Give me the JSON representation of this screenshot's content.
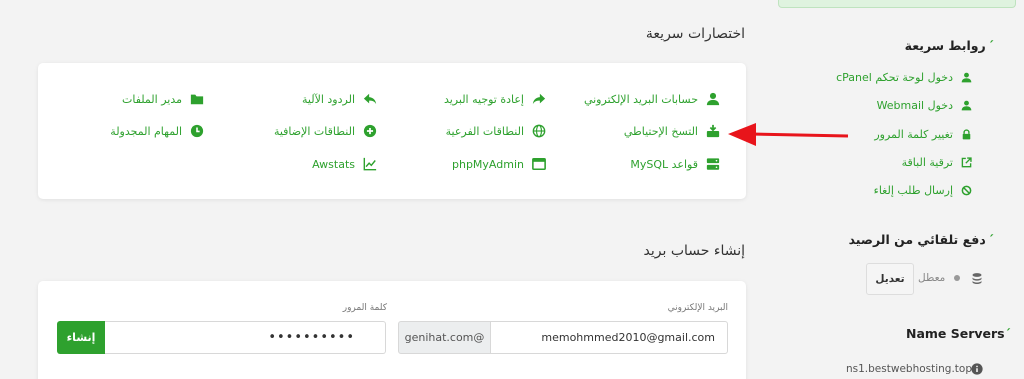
{
  "shortcuts": {
    "title": "اختصارات سريعة",
    "items": [
      {
        "label": "حسابات البريد الإلكتروني",
        "icon": "user-icon"
      },
      {
        "label": "إعادة توجيه البريد",
        "icon": "share-arrow-icon"
      },
      {
        "label": "الردود الآلية",
        "icon": "reply-icon"
      },
      {
        "label": "مدير الملفات",
        "icon": "folder-icon"
      },
      {
        "label": "التسخ الإحتياطي",
        "icon": "backup-icon"
      },
      {
        "label": "النطاقات الفرعية",
        "icon": "globe-icon"
      },
      {
        "label": "النطاقات الإضافية",
        "icon": "plus-circle-icon"
      },
      {
        "label": "المهام المجدولة",
        "icon": "clock-icon"
      },
      {
        "label": "قواعد MySQL",
        "icon": "database-icon"
      },
      {
        "label": "phpMyAdmin",
        "icon": "window-icon"
      },
      {
        "label": "Awstats",
        "icon": "chart-line-icon"
      }
    ]
  },
  "create_email": {
    "title": "إنشاء حساب بريد",
    "email_label": "البريد الإلكتروني",
    "email_value": "memohmmed2010@gmail.com",
    "domain_suffix": "genihat.com@",
    "password_label": "كلمة المرور",
    "password_value": "••••••••••",
    "create_button": "إنشاء"
  },
  "quick_links": {
    "title": "روابط سريعة",
    "items": [
      {
        "label": "دخول لوحة تحكم cPanel",
        "icon": "user-icon"
      },
      {
        "label": "دخول Webmail",
        "icon": "user-icon"
      },
      {
        "label": "تغيير كلمة المرور",
        "icon": "lock-icon"
      },
      {
        "label": "ترقية الباقة",
        "icon": "external-link-icon"
      },
      {
        "label": "إرسال طلب إلغاء",
        "icon": "ban-icon"
      }
    ]
  },
  "auto_pay": {
    "title": "دفع تلقائي من الرصيد",
    "status": "معطل",
    "edit_button": "تعديل"
  },
  "name_servers": {
    "title": "Name Servers",
    "items": [
      "ns1.bestwebhosting.top"
    ]
  },
  "colors": {
    "accent": "#2ea12e",
    "arrow": "#e8141b",
    "background": "#f3f3f3"
  }
}
